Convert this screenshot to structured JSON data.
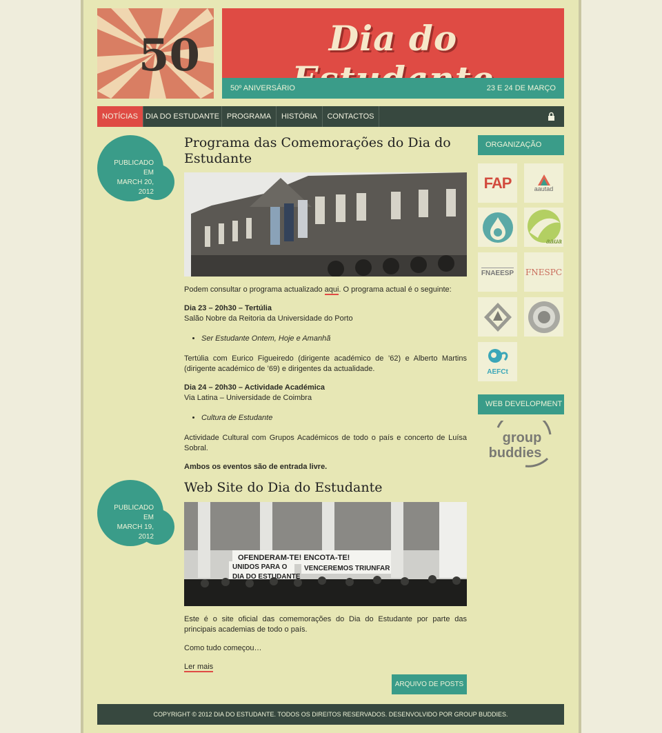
{
  "header": {
    "logo_text": "50",
    "title": "Dia do Estudante",
    "anniversary": "50º ANIVERSÁRIO",
    "dates": "23 E 24 DE MARÇO"
  },
  "nav": {
    "items": [
      "NOTÍCIAS",
      "DIA DO ESTUDANTE",
      "PROGRAMA",
      "HISTÓRIA",
      "CONTACTOS"
    ],
    "lock_icon": "lock-icon"
  },
  "posts": [
    {
      "published_label": "PUBLICADO EM",
      "date_line1": "MARCH 20,",
      "date_line2": "2012",
      "title": "Programa das Comemorações do Dia do Estudante",
      "intro_before": "Podem consultar o programa actualizado ",
      "intro_link": "aqui",
      "intro_after": ". O programa actual é o seguinte:",
      "event1_heading": "Dia 23 – 20h30 – Tertúlia",
      "event1_place": "Salão Nobre da Reitoria da Universidade do Porto",
      "event1_item": "Ser Estudante Ontem, Hoje e Amanhã",
      "event1_desc": "Tertúlia com Eurico Figueiredo (dirigente académico de ’62) e Alberto Martins (dirigente académico de ’69) e dirigentes da actualidade.",
      "event2_heading": "Dia 24 – 20h30 – Actividade Académica",
      "event2_place": "Via Latina – Universidade de Coimbra",
      "event2_item": "Cultura de Estudante",
      "event2_desc": "Actividade Cultural com Grupos Académicos de todo o país e concerto de Luísa Sobral.",
      "closing": "Ambos os eventos são de entrada livre."
    },
    {
      "published_label": "PUBLICADO EM",
      "date_line1": "MARCH 19,",
      "date_line2": "2012",
      "title": "Web Site do Dia do Estudante",
      "banner_line1": "OFENDERAM-TE! ENCOTA-TE!",
      "banner_line2": "UNIDOS PARA O",
      "banner_line3": "DIA DO ESTUDANTE",
      "banner_line4": "VENCEREMOS TRIUNFAR",
      "paragraph": "Este é o site oficial das comemorações do Dia do Estudante por parte das principais academias de todo o país.",
      "teaser": "Como tudo começou…",
      "read_more": "Ler mais"
    }
  ],
  "archive_button": "ARQUIVO DE POSTS",
  "sidebar": {
    "org_heading": "ORGANIZAÇÃO",
    "orgs": [
      "FAP",
      "aautad",
      "",
      "aaua",
      "FNAEESP",
      "FNESPC",
      "",
      "",
      "AEFCt"
    ],
    "web_heading": "WEB DEVELOPMENT",
    "dev_line1": "group",
    "dev_line2": "buddies"
  },
  "footer": "COPYRIGHT © 2012 DIA DO ESTUDANTE. TODOS OS DIREITOS RESERVADOS. DESENVOLVIDO POR GROUP BUDDIES.",
  "colors": {
    "red": "#df4b44",
    "teal": "#3a9c89",
    "dark": "#37483f",
    "paper": "#e7e7b5"
  }
}
